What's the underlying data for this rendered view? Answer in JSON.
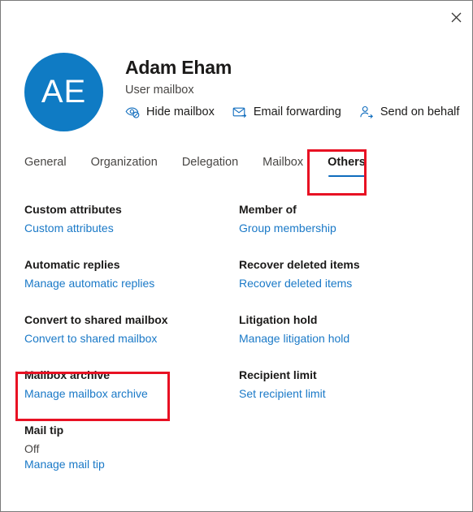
{
  "window": {
    "close_label": "Close",
    "close_icon": "close-icon",
    "border_color": "#7a7a7a"
  },
  "header": {
    "avatar_initials": "AE",
    "avatar_color": "#0f7bc4",
    "display_name": "Adam Eham",
    "mailbox_type": "User mailbox",
    "actions": [
      {
        "label": "Hide mailbox",
        "icon": "eye-hide-icon"
      },
      {
        "label": "Email forwarding",
        "icon": "mail-forward-icon"
      },
      {
        "label": "Send on behalf",
        "icon": "person-arrow-icon"
      }
    ]
  },
  "tabs": {
    "items": [
      {
        "label": "General",
        "active": false
      },
      {
        "label": "Organization",
        "active": false
      },
      {
        "label": "Delegation",
        "active": false
      },
      {
        "label": "Mailbox",
        "active": false
      },
      {
        "label": "Others",
        "active": true
      }
    ],
    "active_underline_color": "#0f6cbd"
  },
  "annotations": {
    "highlight_color": "#e81123",
    "boxes": [
      {
        "target": "tab-others"
      },
      {
        "target": "setting-mailbox-archive"
      }
    ]
  },
  "settings": {
    "link_color": "#1a79c7",
    "items": [
      {
        "title": "Custom attributes",
        "value": null,
        "link": "Custom attributes"
      },
      {
        "title": "Member of",
        "value": null,
        "link": "Group membership"
      },
      {
        "title": "Automatic replies",
        "value": null,
        "link": "Manage automatic replies"
      },
      {
        "title": "Recover deleted items",
        "value": null,
        "link": "Recover deleted items"
      },
      {
        "title": "Convert to shared mailbox",
        "value": null,
        "link": "Convert to shared mailbox"
      },
      {
        "title": "Litigation hold",
        "value": null,
        "link": "Manage litigation hold"
      },
      {
        "title": "Mailbox archive",
        "value": null,
        "link": "Manage mailbox archive"
      },
      {
        "title": "Recipient limit",
        "value": null,
        "link": "Set recipient limit"
      },
      {
        "title": "Mail tip",
        "value": "Off",
        "link": "Manage mail tip"
      }
    ]
  }
}
